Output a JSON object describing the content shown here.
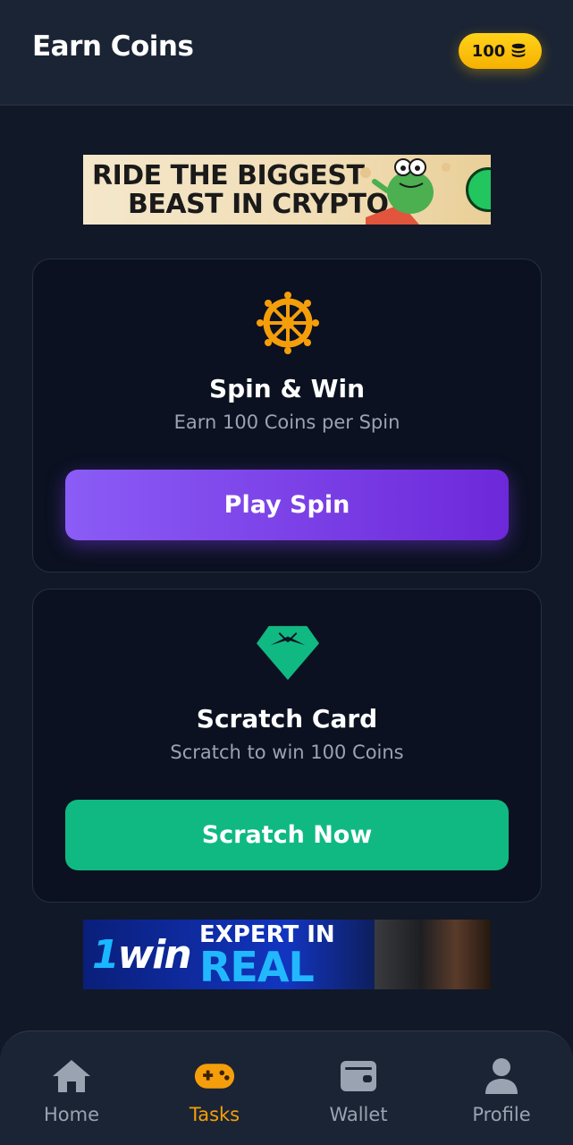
{
  "header": {
    "title": "Earn Coins",
    "coin_balance": "100",
    "coin_icon": "coins-icon"
  },
  "ads": {
    "top": {
      "line1": "RIDE THE BIGGEST",
      "line2": "BEAST IN CRYPTO"
    },
    "bottom": {
      "brand_prefix": "1",
      "brand": "win",
      "line1": "EXPERT IN",
      "line2": "REAL"
    }
  },
  "cards": {
    "spin": {
      "icon": "dharma-wheel-icon",
      "icon_color": "#f59e0b",
      "title": "Spin & Win",
      "subtitle": "Earn 100 Coins per Spin",
      "button_label": "Play Spin",
      "button_color": "#7c3aed"
    },
    "scratch": {
      "icon": "gem-icon",
      "icon_color": "#10b981",
      "title": "Scratch Card",
      "subtitle": "Scratch to win 100 Coins",
      "button_label": "Scratch Now",
      "button_color": "#10b981"
    }
  },
  "nav": {
    "items": [
      {
        "label": "Home",
        "icon": "home-icon",
        "active": false
      },
      {
        "label": "Tasks",
        "icon": "gamepad-icon",
        "active": true
      },
      {
        "label": "Wallet",
        "icon": "wallet-icon",
        "active": false
      },
      {
        "label": "Profile",
        "icon": "user-icon",
        "active": false
      }
    ],
    "active_color": "#f59e0b",
    "inactive_color": "#9aa3b2"
  }
}
